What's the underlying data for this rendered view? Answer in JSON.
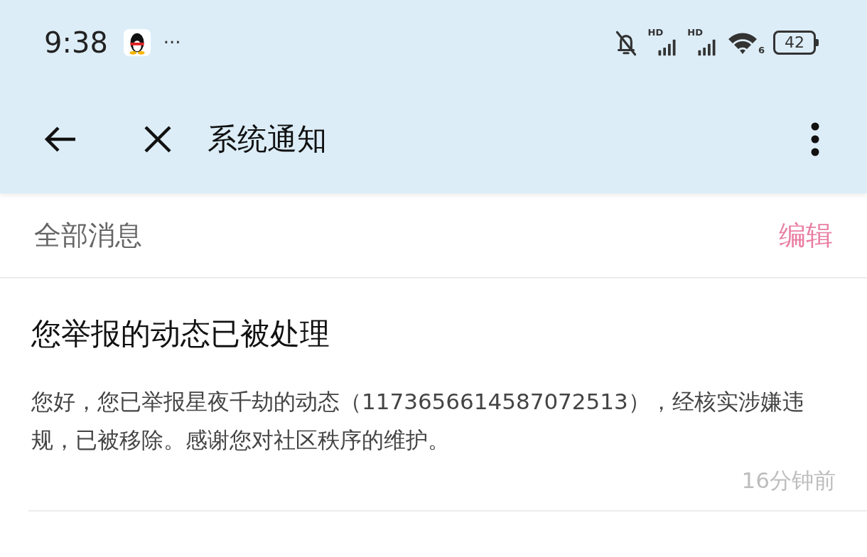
{
  "status_bar": {
    "time": "9:38",
    "more": "···",
    "signals": [
      {
        "label": "HD"
      },
      {
        "label": "HD"
      }
    ],
    "wifi_label": "6",
    "battery": "42"
  },
  "header": {
    "title": "系统通知"
  },
  "filter": {
    "label": "全部消息",
    "action": "编辑"
  },
  "notifications": [
    {
      "title": "您举报的动态已被处理",
      "body": "您好，您已举报星夜千劫的动态（1173656614587072513），经核实涉嫌违规，已被移除。感谢您对社区秩序的维护。",
      "time": "16分钟前"
    }
  ]
}
